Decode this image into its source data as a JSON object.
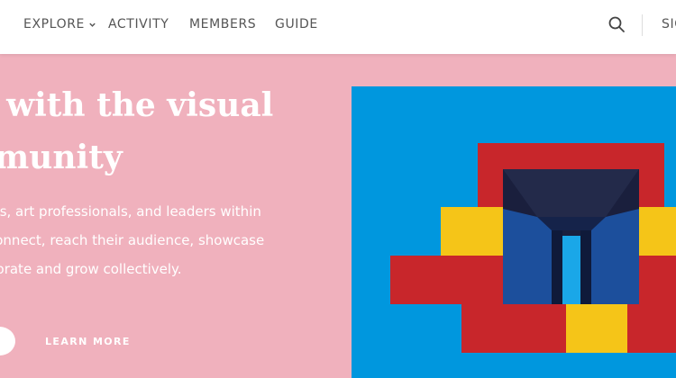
{
  "nav": {
    "items": [
      {
        "label": "EXPLORE"
      },
      {
        "label": "ACTIVITY"
      },
      {
        "label": "MEMBERS"
      },
      {
        "label": "GUIDE"
      }
    ],
    "signin_partial": "SIG"
  },
  "hero": {
    "headline_lines": [
      "ct with the visual",
      "mmunity"
    ],
    "description_lines": [
      "sts, art professionals, and leaders within",
      "connect, reach their audience, showcase",
      "borate and grow collectively."
    ],
    "cta_label": "LEARN MORE"
  },
  "icons": [
    "chevron-down-icon",
    "search-icon"
  ],
  "colors": {
    "background": "#f0b1bd",
    "nav_bg": "#ffffff",
    "art_blue": "#0097de",
    "art_red": "#c8262b",
    "art_yellow": "#f5c518",
    "art_navy": "#1a1f3d"
  }
}
